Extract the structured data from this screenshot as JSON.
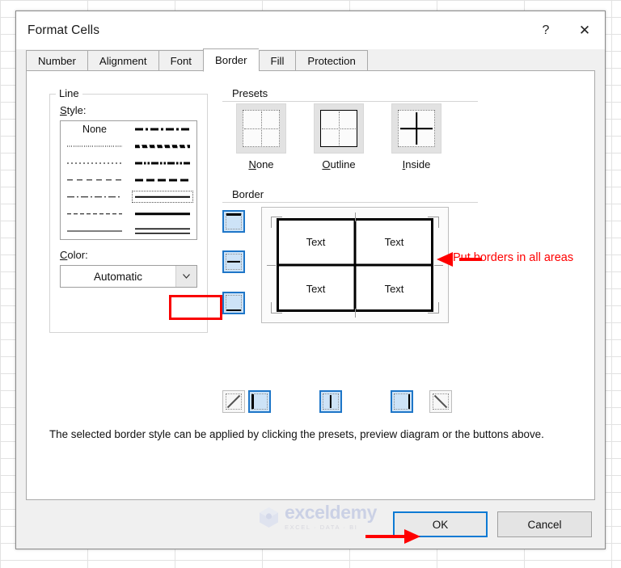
{
  "window": {
    "title": "Format Cells",
    "help_icon": "?",
    "close_icon": "✕"
  },
  "tabs": [
    {
      "label": "Number",
      "active": false
    },
    {
      "label": "Alignment",
      "active": false
    },
    {
      "label": "Font",
      "active": false
    },
    {
      "label": "Border",
      "active": true
    },
    {
      "label": "Fill",
      "active": false
    },
    {
      "label": "Protection",
      "active": false
    }
  ],
  "line_group": {
    "legend": "Line",
    "style_label": "Style:",
    "none_label": "None",
    "styles_left": [
      "none",
      "dotfine",
      "dot",
      "dash",
      "dashdot",
      "dashsm",
      "solid1"
    ],
    "styles_right": [
      "dashdot",
      "slant",
      "dashdotdot",
      "dashmed",
      "solid1-selected",
      "solid3",
      "dbl"
    ],
    "selected_index": 4,
    "selected_column": "right",
    "color_label": "Color:",
    "color_value": "Automatic",
    "color_arrow_icon": "chevron-down-icon"
  },
  "presets": {
    "legend": "Presets",
    "items": [
      {
        "caption": "None",
        "accel": "N",
        "icon": "preset-none-icon"
      },
      {
        "caption": "Outline",
        "accel": "O",
        "icon": "preset-outline-icon"
      },
      {
        "caption": "Inside",
        "accel": "I",
        "icon": "preset-inside-icon"
      }
    ]
  },
  "border_group": {
    "legend": "Border",
    "left_buttons": [
      {
        "name": "border-top-button",
        "icon": "border-top-icon",
        "pressed": true
      },
      {
        "name": "border-horizontal-button",
        "icon": "border-inside-horizontal-icon",
        "pressed": true
      },
      {
        "name": "border-bottom-button",
        "icon": "border-bottom-icon",
        "pressed": true
      }
    ],
    "bottom_buttons": [
      {
        "name": "border-diagonal-up-button",
        "icon": "border-diagonal-up-icon",
        "pressed": false
      },
      {
        "name": "border-left-button",
        "icon": "border-left-icon",
        "pressed": true
      },
      {
        "name": "border-vertical-button",
        "icon": "border-inside-vertical-icon",
        "pressed": true
      },
      {
        "name": "border-right-button",
        "icon": "border-right-icon",
        "pressed": true
      },
      {
        "name": "border-diagonal-down-button",
        "icon": "border-diagonal-down-icon",
        "pressed": false
      }
    ],
    "preview_cells": [
      "Text",
      "Text",
      "Text",
      "Text"
    ]
  },
  "description": "The selected border style can be applied by clicking the presets, preview diagram or the buttons above.",
  "footer": {
    "ok_label": "OK",
    "cancel_label": "Cancel",
    "watermark_name": "exceldemy",
    "watermark_tagline": "EXCEL · DATA · BI"
  },
  "annotations": {
    "border_note": "Put borders in all areas",
    "color": "#ff0000",
    "highlight_color": "#f90000"
  }
}
